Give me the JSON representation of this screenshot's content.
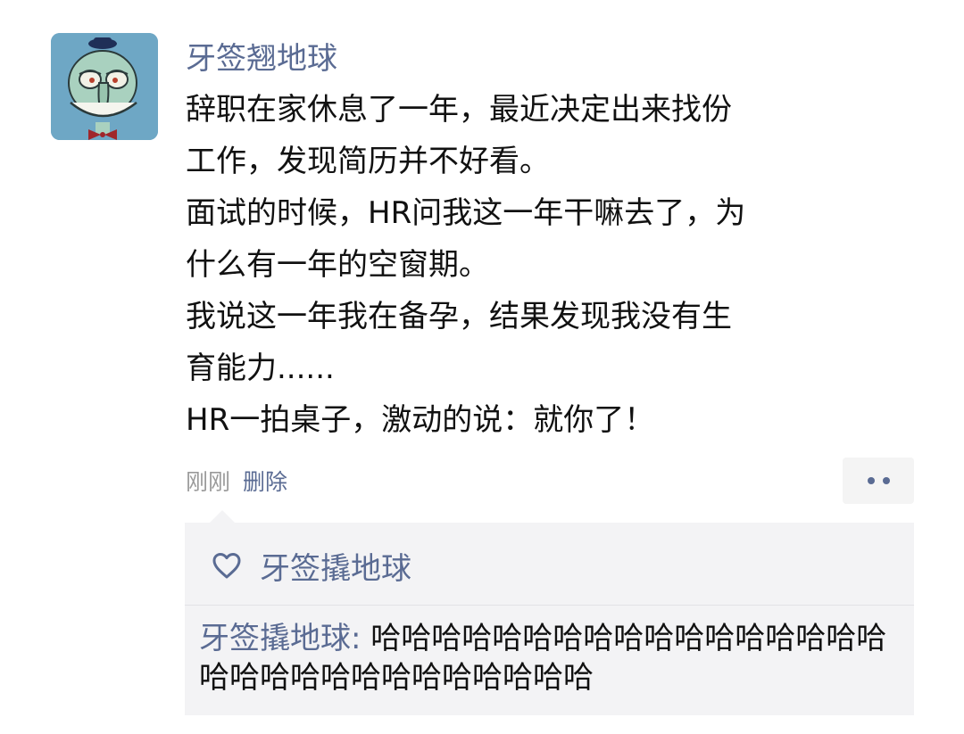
{
  "post": {
    "author": "牙签翘地球",
    "lines": [
      "辞职在家休息了一年，最近决定出来找份",
      "工作，发现简历并不好看。",
      "面试的时候，HR问我这一年干嘛去了，为",
      "什么有一年的空窗期。",
      "我说这一年我在备孕，结果发现我没有生",
      "育能力......",
      "HR一拍桌子，激动的说：就你了！"
    ],
    "time": "刚刚",
    "delete_label": "删除",
    "more_icon": "more-dots-icon"
  },
  "likes": {
    "icon": "heart-icon",
    "users": [
      "牙签撬地球"
    ]
  },
  "comments": [
    {
      "author": "牙签撬地球",
      "separator": ": ",
      "text": "哈哈哈哈哈哈哈哈哈哈哈哈哈哈哈哈哈哈哈哈哈哈哈哈哈哈哈哈哈哈"
    }
  ],
  "colors": {
    "link": "#5a6b93",
    "text": "#111111",
    "meta": "#9a9a9a",
    "panel_bg": "#f3f3f5",
    "avatar_bg": "#6ea7c5"
  }
}
